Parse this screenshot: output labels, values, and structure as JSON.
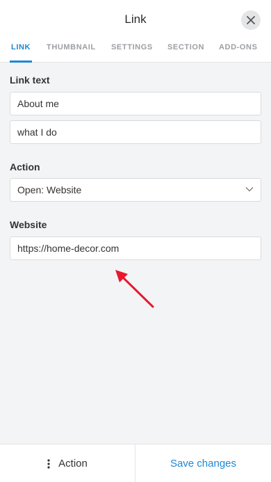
{
  "header": {
    "title": "Link"
  },
  "tabs": [
    {
      "label": "LINK"
    },
    {
      "label": "THUMBNAIL"
    },
    {
      "label": "SETTINGS"
    },
    {
      "label": "SECTION"
    },
    {
      "label": "ADD-ONS"
    }
  ],
  "active_tab": "LINK",
  "link_text": {
    "label": "Link text",
    "line1": "About me",
    "line2": "what I do"
  },
  "action": {
    "label": "Action",
    "value": "Open: Website"
  },
  "website": {
    "label": "Website",
    "value": "https://home-decor.com"
  },
  "footer": {
    "action_label": "Action",
    "save_label": "Save changes"
  },
  "colors": {
    "accent": "#1a88d4",
    "annotation_arrow": "#e8192c"
  }
}
